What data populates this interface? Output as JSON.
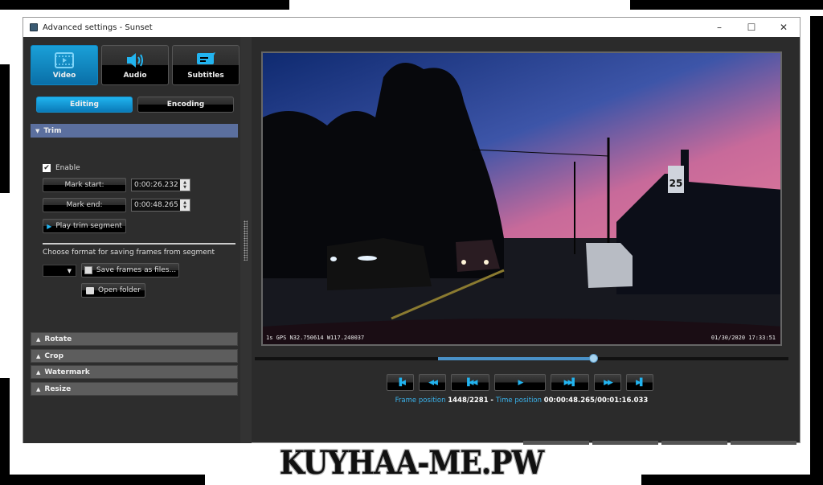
{
  "window": {
    "title": "Advanced settings - Sunset",
    "controls": {
      "minimize": "–",
      "maximize": "☐",
      "close": "✕"
    }
  },
  "main_tabs": [
    {
      "label": "Video",
      "icon": "film-icon",
      "active": true
    },
    {
      "label": "Audio",
      "icon": "speaker-icon",
      "active": false
    },
    {
      "label": "Subtitles",
      "icon": "speech-bubble-icon",
      "active": false
    }
  ],
  "sub_tabs": [
    {
      "label": "Editing",
      "active": true
    },
    {
      "label": "Encoding",
      "active": false
    }
  ],
  "trim": {
    "header": "Trim",
    "expanded": true,
    "enable_label": "Enable",
    "enable_checked": true,
    "check_mark": "✔",
    "mark_start_label": "Mark start:",
    "mark_start_value": "0:00:26.232",
    "mark_end_label": "Mark end:",
    "mark_end_value": "0:00:48.265",
    "play_segment_label": "Play trim segment",
    "format_label": "Choose format for saving frames from segment",
    "format_value": "",
    "save_frames_label": "Save frames as files...",
    "open_folder_label": "Open folder"
  },
  "collapsed_sections": [
    {
      "label": "Rotate"
    },
    {
      "label": "Crop"
    },
    {
      "label": "Watermark"
    },
    {
      "label": "Resize"
    }
  ],
  "preview": {
    "osd_left": "1s GPS N32.750614 W117.240037",
    "osd_right": "01/30/2020 17:33:51",
    "speed_sign": "25"
  },
  "playback": {
    "trim_start_fraction": 0.344,
    "position_fraction": 0.635,
    "buttons": [
      {
        "name": "go-to-start",
        "glyph": "▐◀"
      },
      {
        "name": "previous-frame",
        "glyph": "◀◀"
      },
      {
        "name": "previous-keyframe",
        "glyph": "▐◀◀"
      },
      {
        "name": "play",
        "glyph": "▶"
      },
      {
        "name": "next-keyframe",
        "glyph": "▶▶▌"
      },
      {
        "name": "next-frame",
        "glyph": "▶▶"
      },
      {
        "name": "go-to-end",
        "glyph": "▶▌"
      }
    ],
    "frame_position_label": "Frame position",
    "frame_position_value": "1448/2281",
    "separator": " - ",
    "time_position_label": "Time position",
    "time_position_value": "00:00:48.265/00:01:16.033"
  },
  "watermark_text": "KUYHAA-ME.PW",
  "colors": {
    "accent": "#1aa0d8",
    "section_open": "#5b6f9e",
    "status_key": "#3ab4ee"
  }
}
